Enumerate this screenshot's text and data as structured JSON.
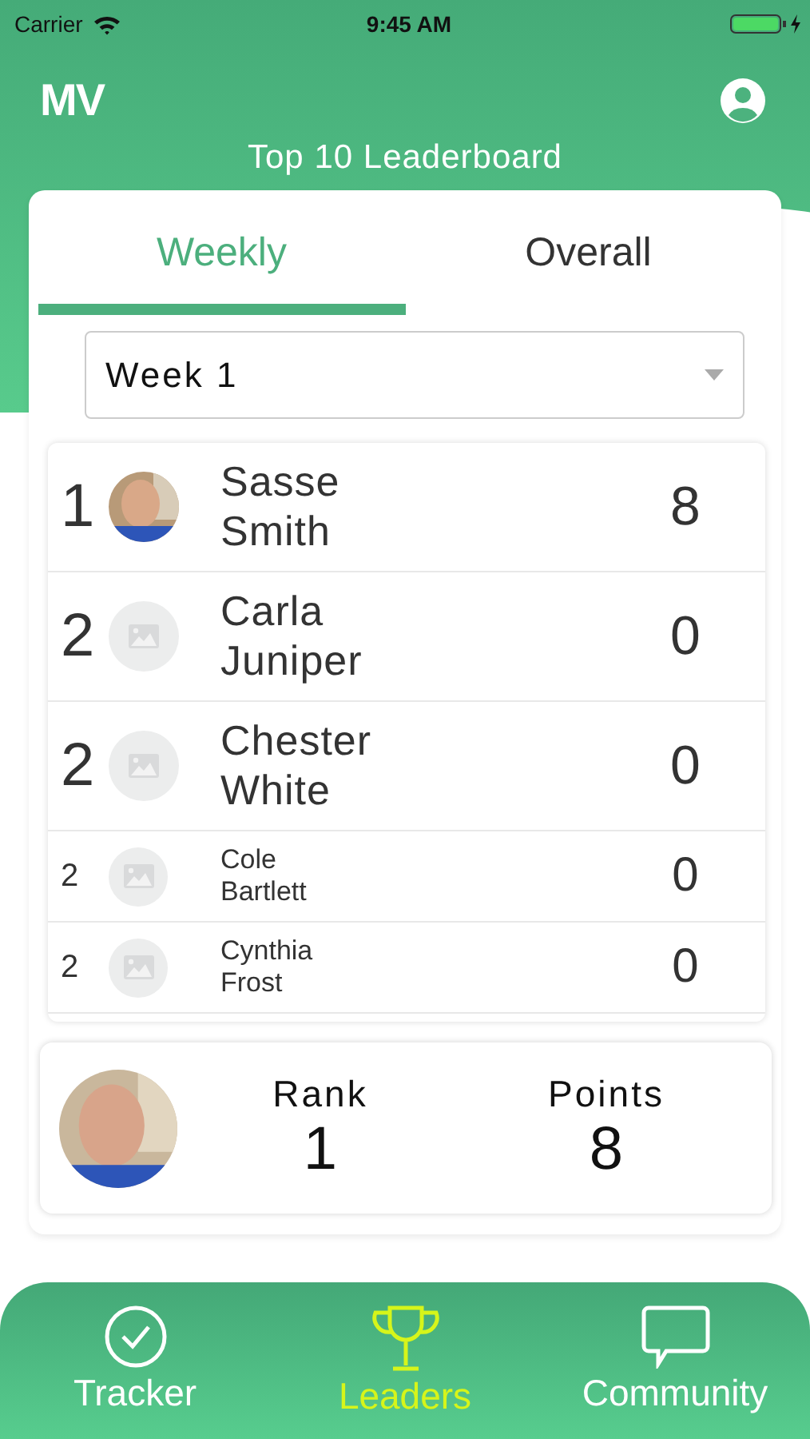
{
  "status_bar": {
    "carrier": "Carrier",
    "time": "9:45 AM"
  },
  "header": {
    "logo": "MV",
    "title": "Top 10 Leaderboard"
  },
  "tabs": [
    {
      "label": "Weekly",
      "selected": true
    },
    {
      "label": "Overall",
      "selected": false
    }
  ],
  "week_select": {
    "value": "Week 1"
  },
  "leaders": [
    {
      "rank": "1",
      "first": "Sasse",
      "last": "Smith",
      "points": "8",
      "kind": "large",
      "photo": true
    },
    {
      "rank": "2",
      "first": "Carla",
      "last": "Juniper",
      "points": "0",
      "kind": "large",
      "photo": false
    },
    {
      "rank": "2",
      "first": "Chester",
      "last": "White",
      "points": "0",
      "kind": "large",
      "photo": false
    },
    {
      "rank": "2",
      "first": "Cole",
      "last": "Bartlett",
      "points": "0",
      "kind": "small",
      "photo": false
    },
    {
      "rank": "2",
      "first": "Cynthia",
      "last": "Frost",
      "points": "0",
      "kind": "small",
      "photo": false
    }
  ],
  "my_stats": {
    "rank_label": "Rank",
    "rank": "1",
    "points_label": "Points",
    "points": "8"
  },
  "nav": [
    {
      "label": "Tracker",
      "selected": false,
      "kind": "check"
    },
    {
      "label": "Leaders",
      "selected": true,
      "kind": "trophy"
    },
    {
      "label": "Community",
      "selected": false,
      "kind": "chat"
    }
  ]
}
